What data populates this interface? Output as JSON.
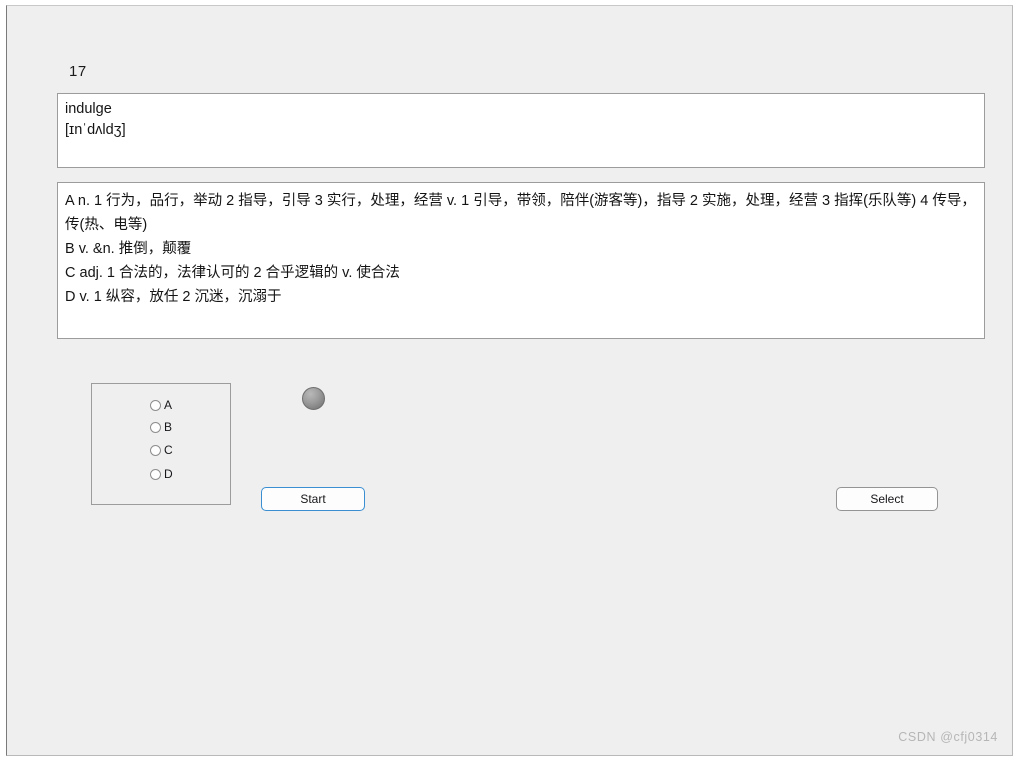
{
  "window": {
    "background_color": "#efefef",
    "border_color": "#7a7a7a"
  },
  "index_label": "17",
  "word_card": {
    "word": "indulge",
    "phonetic": "[ɪnˈdʌldʒ]"
  },
  "definitions": {
    "options": [
      "A n. 1 行为，品行，举动 2 指导，引导 3 实行，处理，经营 v. 1 引导，带领，陪伴(游客等)，指导 2 实施，处理，经营 3 指挥(乐队等) 4 传导，传(热、电等)",
      "B v. &n. 推倒，颠覆",
      "C adj. 1 合法的，法律认可的 2 合乎逻辑的 v. 使合法",
      "D v. 1 纵容，放任 2 沉迷，沉溺于"
    ]
  },
  "choices": {
    "items": [
      {
        "label": "A",
        "selected": false
      },
      {
        "label": "B",
        "selected": false
      },
      {
        "label": "C",
        "selected": false
      },
      {
        "label": "D",
        "selected": false
      }
    ]
  },
  "indicator": {
    "name": "status-lamp",
    "color": "#949494",
    "state": "off"
  },
  "buttons": {
    "start": "Start",
    "select": "Select",
    "start_focus_color": "#3a8fd3",
    "select_border_color": "#949494"
  },
  "watermark": "CSDN @cfj0314"
}
